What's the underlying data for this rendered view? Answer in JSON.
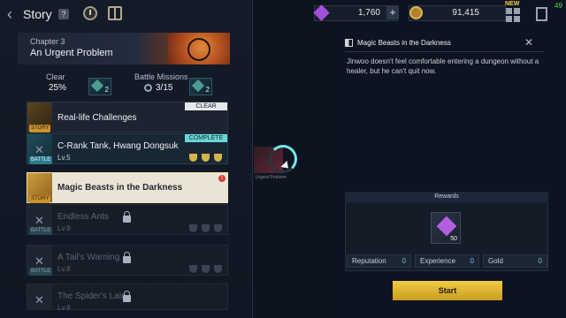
{
  "header": {
    "title": "Story",
    "help": "?",
    "currency_gems": "1,760",
    "currency_plus": "+",
    "currency_gold": "91,415",
    "new_badge": "NEW",
    "corner_number": "49"
  },
  "chapter": {
    "number": "Chapter 3",
    "title": "An Urgent Problem",
    "clear_label": "Clear",
    "clear_value": "25%",
    "clear_reward_count": "2",
    "battle_missions_label": "Battle Missions",
    "battle_missions_value": "3/15",
    "battle_reward_count": "2"
  },
  "stages": [
    {
      "name": "Real-life Challenges",
      "type": "STORY",
      "status": "CLEAR"
    },
    {
      "name": "C-Rank Tank, Hwang Dongsuk",
      "type": "BATTLE",
      "level": "Lv.5",
      "status": "COMPLETE"
    },
    {
      "name": "Magic Beasts in the Darkness",
      "type": "STORY",
      "alert": "!"
    },
    {
      "name": "Endless Ants",
      "type": "BATTLE",
      "level": "Lv.8"
    },
    {
      "name": "A Tail's Warning",
      "type": "BATTLE",
      "level": "Lv.8"
    },
    {
      "name": "The Spider's Lair",
      "type": "BATTLE",
      "level": "Lv.8"
    }
  ],
  "detail": {
    "title": "Magic Beasts in the Darkness",
    "close": "✕",
    "description": "Jinwoo doesn't feel comfortable entering a dungeon without a healer, but he can't quit now.",
    "rewards_header": "Rewards",
    "reward_count": "50",
    "stats": [
      {
        "label": "Reputation",
        "value": "0"
      },
      {
        "label": "Experience",
        "value": "0"
      },
      {
        "label": "Gold",
        "value": "0"
      }
    ],
    "start_label": "Start"
  },
  "loading": {
    "thumbnail_caption": "Urgent Problem"
  },
  "colors": {
    "accent_teal": "#74e7e8",
    "start_gold": "#f0cd46",
    "gem_purple": "#a54fd9"
  }
}
